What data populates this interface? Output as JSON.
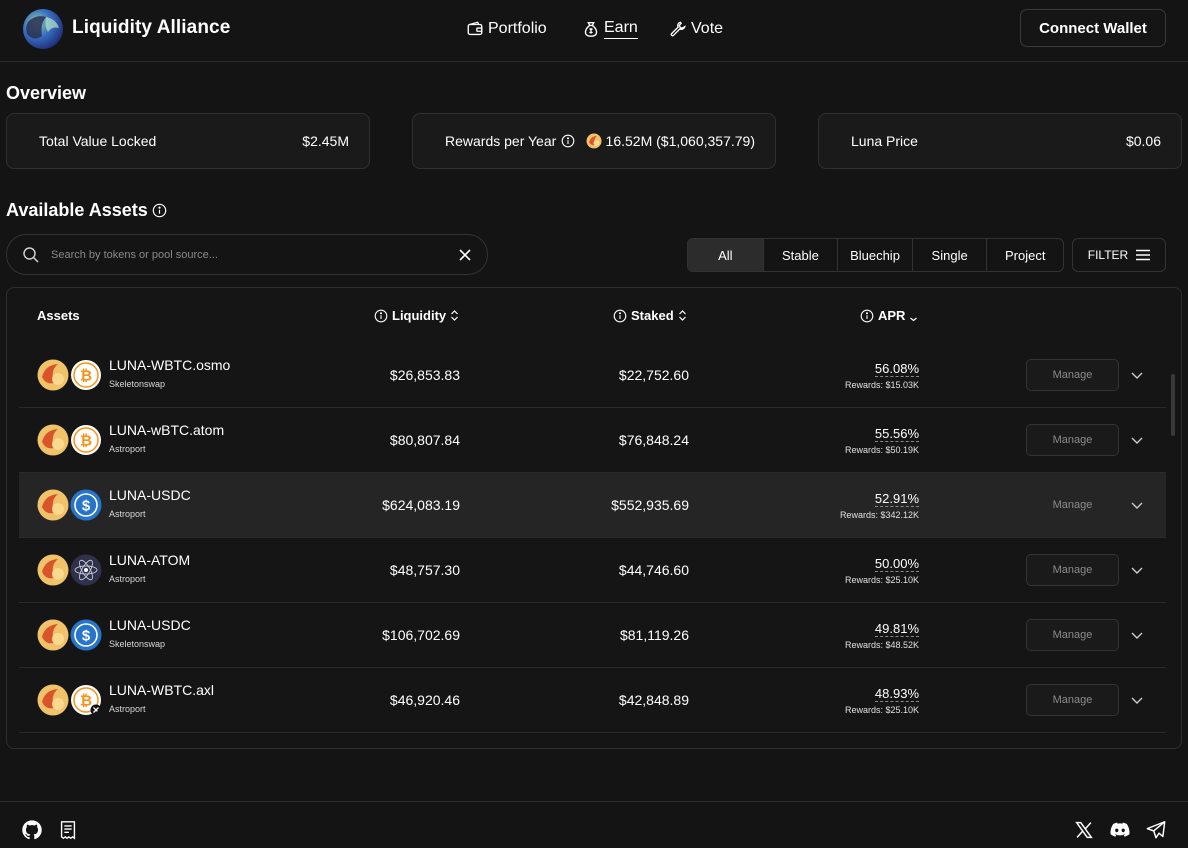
{
  "brand": {
    "name": "Liquidity Alliance"
  },
  "nav": {
    "portfolio": "Portfolio",
    "earn": "Earn",
    "vote": "Vote"
  },
  "connect_wallet": "Connect Wallet",
  "overview": {
    "title": "Overview",
    "tvl_label": "Total Value Locked",
    "tvl_value": "$2.45M",
    "rewards_label": "Rewards per Year",
    "rewards_value": "16.52M ($1,060,357.79)",
    "luna_label": "Luna Price",
    "luna_value": "$0.06"
  },
  "assets": {
    "title": "Available Assets",
    "search_placeholder": "Search by tokens or pool source...",
    "tabs": [
      "All",
      "Stable",
      "Bluechip",
      "Single",
      "Project"
    ],
    "active_tab": "All",
    "filter_label": "FILTER",
    "headers": {
      "assets": "Assets",
      "liquidity": "Liquidity",
      "staked": "Staked",
      "apr": "APR"
    },
    "manage_label": "Manage",
    "rows": [
      {
        "name": "LUNA-WBTC.osmo",
        "source": "Skeletonswap",
        "liquidity": "$26,853.83",
        "staked": "$22,752.60",
        "apr": "56.08%",
        "rewards": "Rewards: $15.03K",
        "token2": "btc-icon"
      },
      {
        "name": "LUNA-wBTC.atom",
        "source": "Astroport",
        "liquidity": "$80,807.84",
        "staked": "$76,848.24",
        "apr": "55.56%",
        "rewards": "Rewards: $50.19K",
        "token2": "btc-icon"
      },
      {
        "name": "LUNA-USDC",
        "source": "Astroport",
        "liquidity": "$624,083.19",
        "staked": "$552,935.69",
        "apr": "52.91%",
        "rewards": "Rewards: $342.12K",
        "token2": "usdc-icon"
      },
      {
        "name": "LUNA-ATOM",
        "source": "Astroport",
        "liquidity": "$48,757.30",
        "staked": "$44,746.60",
        "apr": "50.00%",
        "rewards": "Rewards: $25.10K",
        "token2": "atom-icon"
      },
      {
        "name": "LUNA-USDC",
        "source": "Skeletonswap",
        "liquidity": "$106,702.69",
        "staked": "$81,119.26",
        "apr": "49.81%",
        "rewards": "Rewards: $48.52K",
        "token2": "usdc-icon"
      },
      {
        "name": "LUNA-WBTC.axl",
        "source": "Astroport",
        "liquidity": "$46,920.46",
        "staked": "$42,848.89",
        "apr": "48.93%",
        "rewards": "Rewards: $25.10K",
        "token2": "btc-axl-icon"
      }
    ]
  },
  "colors": {
    "background": "#141414",
    "card": "#1a1a1a",
    "border": "#303030",
    "highlight_row": "#252525",
    "luna": "#f5b83d",
    "btc": "#f7931a",
    "usdc": "#2775ca"
  }
}
